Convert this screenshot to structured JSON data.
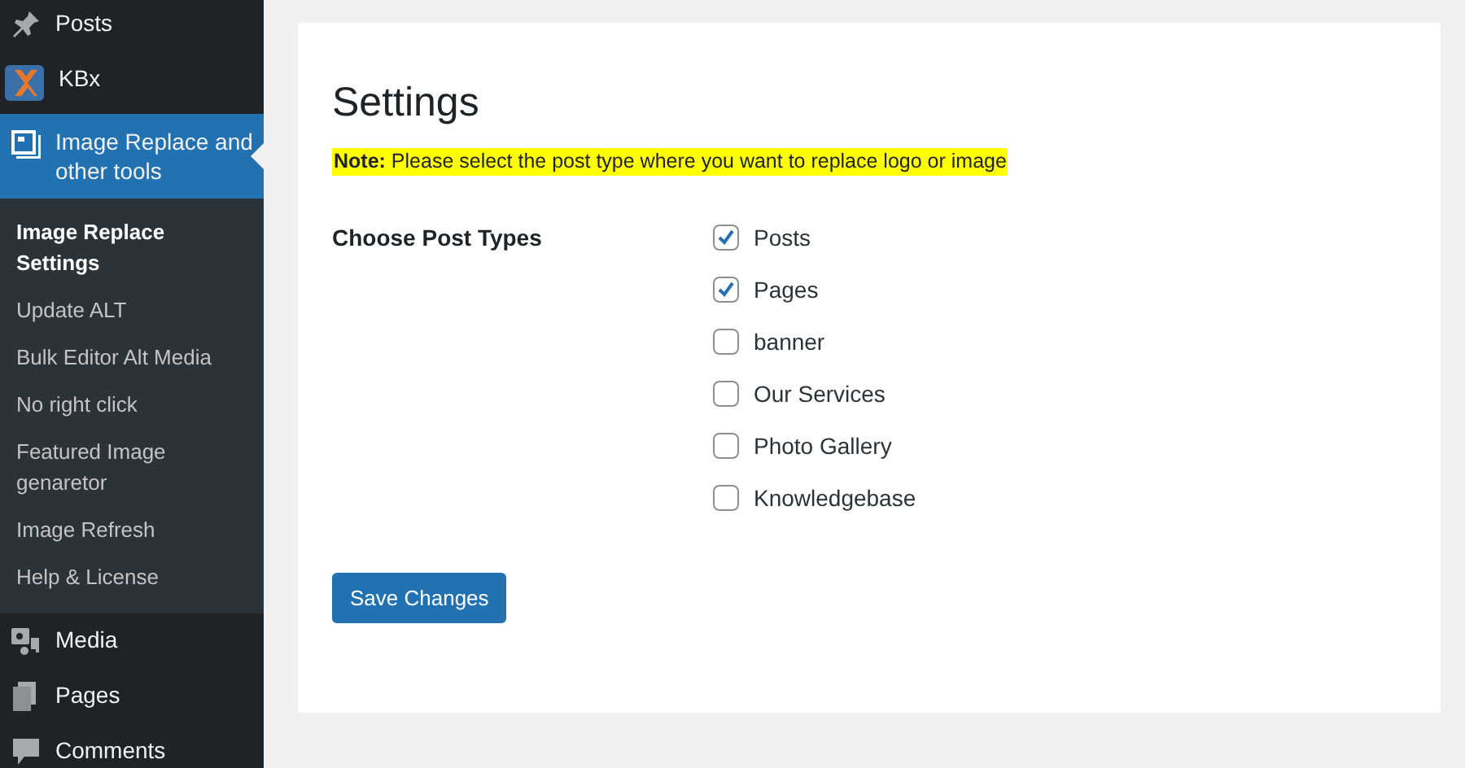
{
  "sidebar": {
    "items": [
      {
        "label": "Posts",
        "current": false
      },
      {
        "label": "KBx",
        "current": false
      },
      {
        "label": "Image Replace and other tools",
        "current": true,
        "submenu": [
          {
            "label": "Image Replace Settings",
            "selected": true
          },
          {
            "label": "Update ALT",
            "selected": false
          },
          {
            "label": "Bulk Editor Alt Media",
            "selected": false
          },
          {
            "label": "No right click",
            "selected": false
          },
          {
            "label": "Featured Image genaretor",
            "selected": false
          },
          {
            "label": "Image Refresh",
            "selected": false
          },
          {
            "label": "Help & License",
            "selected": false
          }
        ]
      },
      {
        "label": "Media",
        "current": false
      },
      {
        "label": "Pages",
        "current": false
      },
      {
        "label": "Comments",
        "current": false
      }
    ]
  },
  "page": {
    "title": "Settings",
    "note": "**Note:** Please select the post type where you want to replace logo or image",
    "field_label": "Choose Post Types",
    "options": [
      {
        "label": "Posts",
        "checked": true
      },
      {
        "label": "Pages",
        "checked": true
      },
      {
        "label": "banner",
        "checked": false
      },
      {
        "label": "Our Services",
        "checked": false
      },
      {
        "label": "Photo Gallery",
        "checked": false
      },
      {
        "label": "Knowledgebase",
        "checked": false
      }
    ],
    "save_button": "Save Changes"
  }
}
